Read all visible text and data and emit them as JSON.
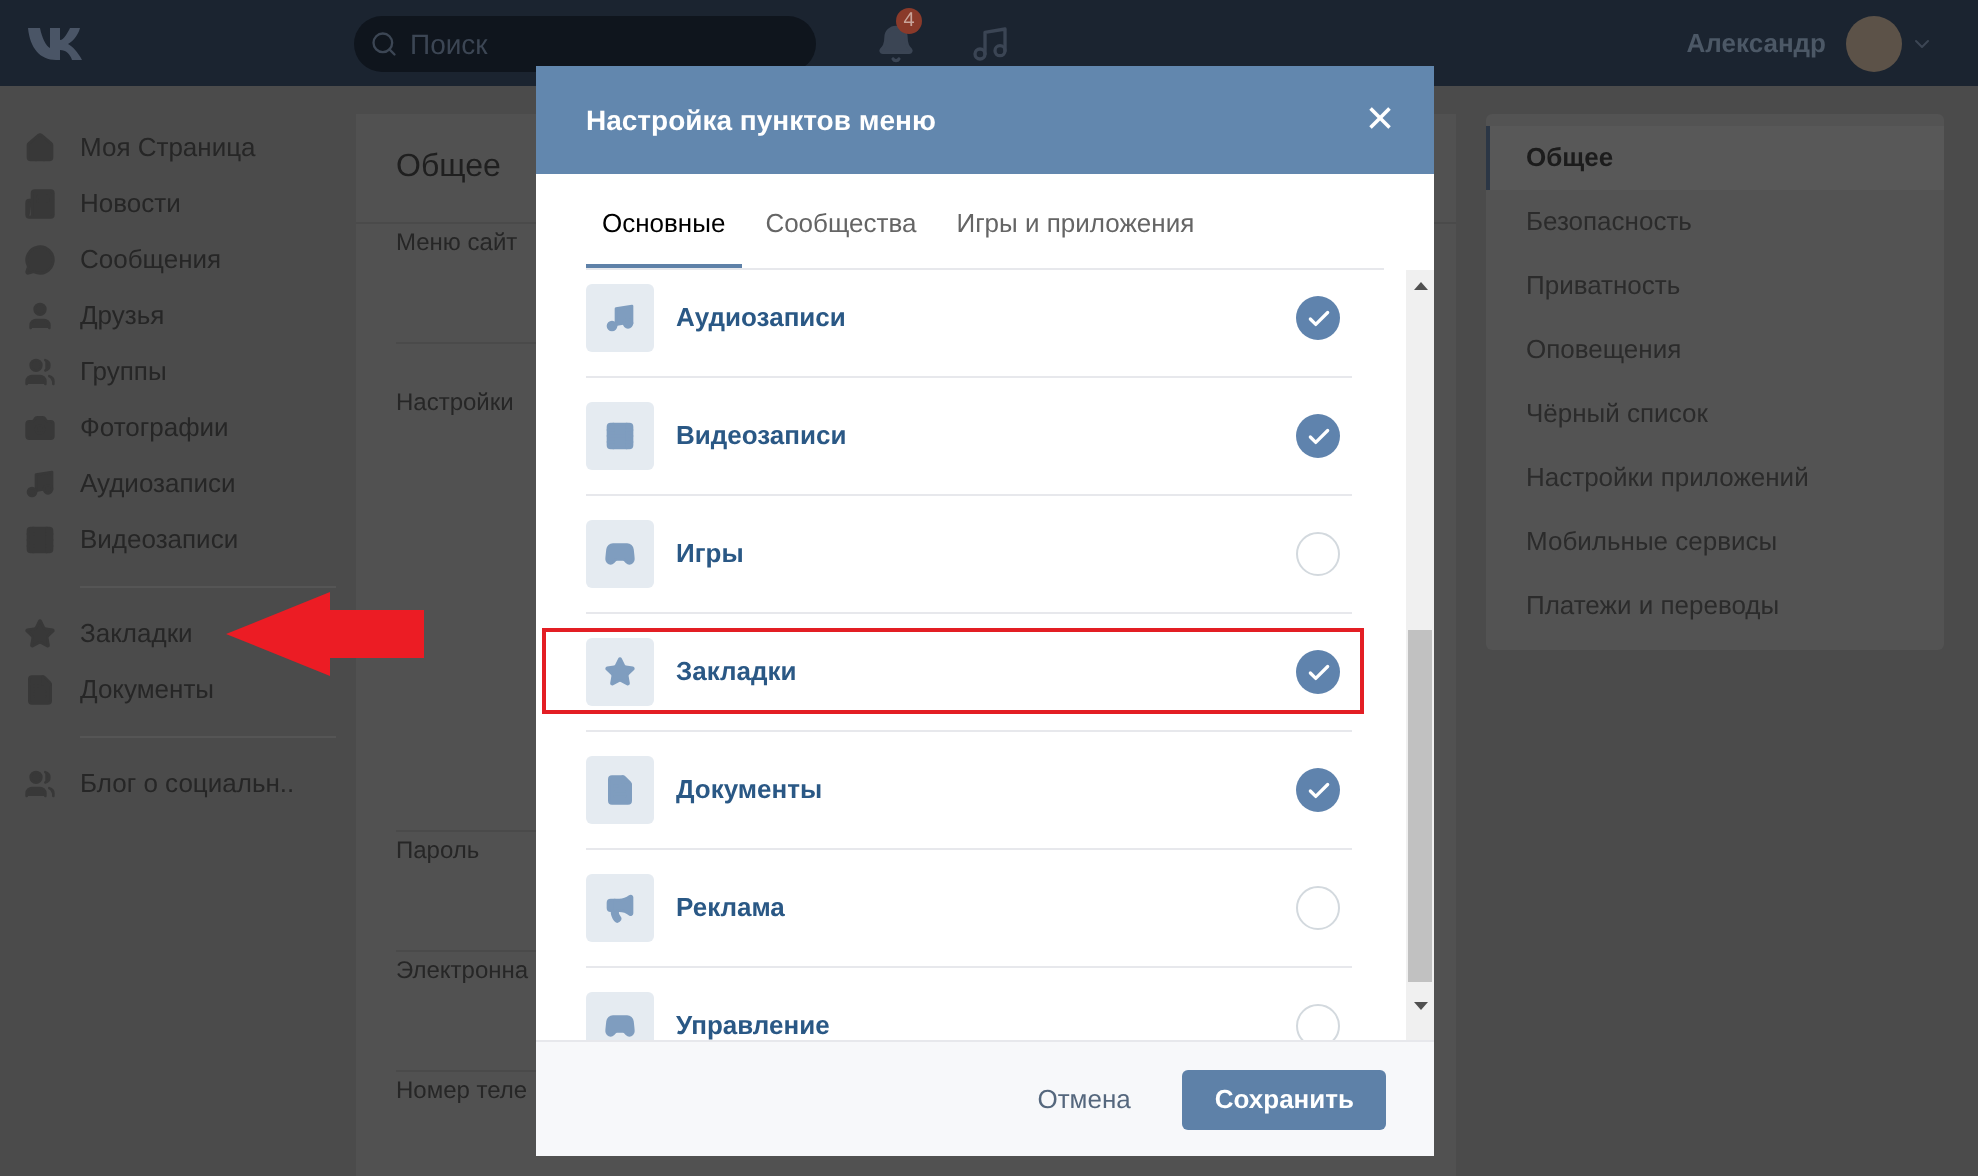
{
  "header": {
    "search": {
      "placeholder": "Поиск"
    },
    "notifications_badge": "4",
    "user_name": "Александр"
  },
  "sidebar": {
    "groups": [
      [
        {
          "label": "Моя Страница"
        },
        {
          "label": "Новости"
        },
        {
          "label": "Сообщения"
        },
        {
          "label": "Друзья"
        },
        {
          "label": "Группы"
        },
        {
          "label": "Фотографии"
        },
        {
          "label": "Аудиозаписи"
        },
        {
          "label": "Видеозаписи"
        }
      ],
      [
        {
          "label": "Закладки"
        },
        {
          "label": "Документы"
        }
      ],
      [
        {
          "label": "Блог о социальн.."
        }
      ]
    ]
  },
  "settings_card": {
    "title": "Общее",
    "rows": [
      {
        "label": "Меню сайт"
      },
      {
        "label": "Настройки"
      },
      {
        "label": "Пароль"
      },
      {
        "label": "Электронна"
      },
      {
        "label": "Номер теле"
      }
    ]
  },
  "settings_menu": {
    "items": [
      {
        "label": "Общее",
        "selected": true
      },
      {
        "label": "Безопасность",
        "selected": false
      },
      {
        "label": "Приватность",
        "selected": false
      },
      {
        "label": "Оповещения",
        "selected": false
      },
      {
        "label": "Чёрный список",
        "selected": false
      },
      {
        "label": "Настройки приложений",
        "selected": false
      },
      {
        "label": "Мобильные сервисы",
        "selected": false
      },
      {
        "label": "Платежи и переводы",
        "selected": false
      }
    ]
  },
  "modal": {
    "title": "Настройка пунктов меню",
    "close": "×",
    "tabs": [
      {
        "label": "Основные",
        "selected": true
      },
      {
        "label": "Сообщества",
        "selected": false
      },
      {
        "label": "Игры и приложения",
        "selected": false
      }
    ],
    "items": [
      {
        "label": "Аудиозаписи",
        "checked": true,
        "highlighted": false
      },
      {
        "label": "Видеозаписи",
        "checked": true,
        "highlighted": false
      },
      {
        "label": "Игры",
        "checked": false,
        "highlighted": false
      },
      {
        "label": "Закладки",
        "checked": true,
        "highlighted": true
      },
      {
        "label": "Документы",
        "checked": true,
        "highlighted": false
      },
      {
        "label": "Реклама",
        "checked": false,
        "highlighted": false
      },
      {
        "label": "Управление",
        "checked": false,
        "highlighted": false
      }
    ],
    "cancel": "Отмена",
    "save": "Сохранить"
  }
}
